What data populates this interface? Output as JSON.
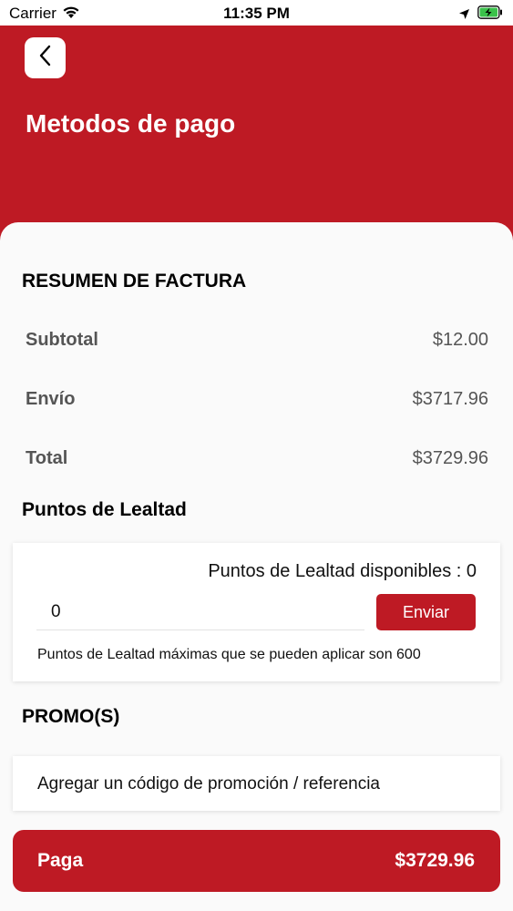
{
  "status_bar": {
    "carrier": "Carrier",
    "time": "11:35 PM"
  },
  "header": {
    "title": "Metodos de pago",
    "back_icon": "chevron-left-icon",
    "color": "#be1a24"
  },
  "invoice": {
    "title": "RESUMEN DE FACTURA",
    "rows": [
      {
        "label": "Subtotal",
        "value": "$12.00"
      },
      {
        "label": "Envío",
        "value": "$3717.96"
      },
      {
        "label": "Total",
        "value": "$3729.96"
      }
    ]
  },
  "loyalty": {
    "title": "Puntos de Lealtad",
    "available_text": "Puntos de Lealtad disponibles : 0",
    "input_value": "0",
    "send_label": "Enviar",
    "note": "Puntos de Lealtad máximas que se pueden aplicar son 600"
  },
  "promo": {
    "title": "PROMO(S)",
    "add_label": "Agregar un código de promoción / referencia"
  },
  "pay": {
    "label": "Paga",
    "amount": "$3729.96"
  }
}
